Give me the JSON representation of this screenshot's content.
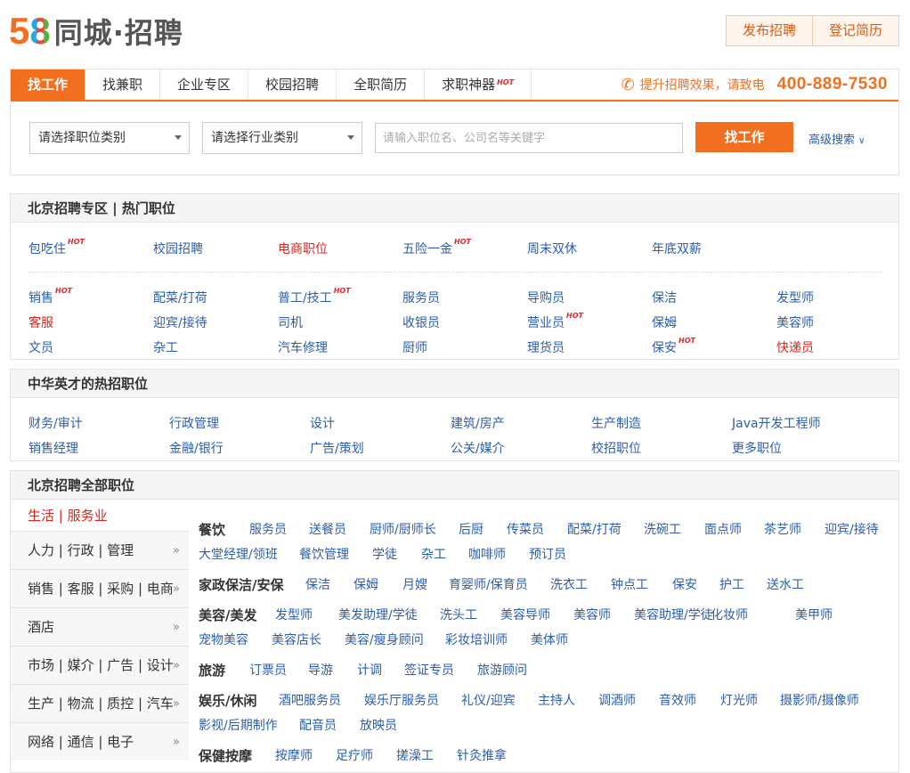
{
  "logo": {
    "digit5": "5",
    "digit8": "8",
    "brand": "同城·招聘"
  },
  "top_buttons": {
    "post": "发布招聘",
    "resume": "登记简历"
  },
  "tabs": [
    {
      "label": "找工作"
    },
    {
      "label": "找兼职"
    },
    {
      "label": "企业专区"
    },
    {
      "label": "校园招聘"
    },
    {
      "label": "全职简历"
    },
    {
      "label": "求职神器"
    }
  ],
  "hot_text": "HOT",
  "phone": {
    "text": "提升招聘效果，请致电",
    "number": "400-889-7530"
  },
  "search": {
    "job_category": "请选择职位类别",
    "industry_category": "请选择行业类别",
    "keyword_placeholder": "请输入职位名、公司名等关键字",
    "find_button": "找工作",
    "advanced": "高级搜索"
  },
  "hot_section": {
    "title": "北京招聘专区 | 热门职位",
    "tags": [
      "包吃住",
      "校园招聘",
      "电商职位",
      "五险一金",
      "周末双休",
      "年底双薪"
    ],
    "jobs": [
      [
        "销售",
        "配菜/打荷",
        "普工/技工",
        "服务员",
        "导购员",
        "保洁",
        "发型师"
      ],
      [
        "客服",
        "迎宾/接待",
        "司机",
        "收银员",
        "营业员",
        "保姆",
        "美容师"
      ],
      [
        "文员",
        "杂工",
        "汽车修理",
        "厨师",
        "理货员",
        "保安",
        "快递员"
      ]
    ]
  },
  "zhrc_section": {
    "title": "中华英才的热招职位",
    "rows": [
      [
        "财务/审计",
        "行政管理",
        "设计",
        "建筑/房产",
        "生产制造",
        "Java开发工程师"
      ],
      [
        "销售经理",
        "金融/银行",
        "广告/策划",
        "公关/媒介",
        "校招职位",
        "更多职位"
      ]
    ]
  },
  "all_section": {
    "title": "北京招聘全部职位",
    "categories": [
      "生活 | 服务业",
      "人力 | 行政 | 管理",
      "销售 | 客服 | 采购 | 电商",
      "酒店",
      "市场 | 媒介 | 广告 | 设计",
      "生产 | 物流 | 质控 | 汽车",
      "网络 | 通信 | 电子"
    ],
    "groups": [
      {
        "name": "餐饮",
        "line1": [
          "服务员",
          "送餐员",
          "厨师/厨师长",
          "后厨",
          "传菜员",
          "配菜/打荷",
          "洗碗工",
          "面点师",
          "茶艺师",
          "迎宾/接待"
        ],
        "line2": [
          "大堂经理/领班",
          "餐饮管理",
          "学徒",
          "杂工",
          "咖啡师",
          "预订员"
        ]
      },
      {
        "name": "家政保洁/安保",
        "line1": [
          "保洁",
          "保姆",
          "月嫂",
          "育婴师/保育员",
          "洗衣工",
          "钟点工",
          "保安",
          "护工",
          "送水工"
        ]
      },
      {
        "name": "美容/美发",
        "line1": [
          "发型师",
          "美发助理/学徒",
          "洗头工",
          "美容导师",
          "美容师",
          "美容助理/学徒",
          "化妆师",
          "美甲师"
        ],
        "line2": [
          "宠物美容",
          "美容店长",
          "美容/瘦身顾问",
          "彩妆培训师",
          "美体师"
        ]
      },
      {
        "name": "旅游",
        "line1": [
          "订票员",
          "导游",
          "计调",
          "签证专员",
          "旅游顾问"
        ]
      },
      {
        "name": "娱乐/休闲",
        "line1": [
          "酒吧服务员",
          "娱乐厅服务员",
          "礼仪/迎宾",
          "主持人",
          "调酒师",
          "音效师",
          "灯光师",
          "摄影师/摄像师"
        ],
        "line2": [
          "影视/后期制作",
          "配音员",
          "放映员"
        ]
      },
      {
        "name": "保健按摩",
        "line1": [
          "按摩师",
          "足疗师",
          "搓澡工",
          "针灸推拿"
        ]
      }
    ]
  },
  "colors": {
    "accent": "#f36f20",
    "link": "#2a5db0",
    "red": "#d9261c"
  }
}
